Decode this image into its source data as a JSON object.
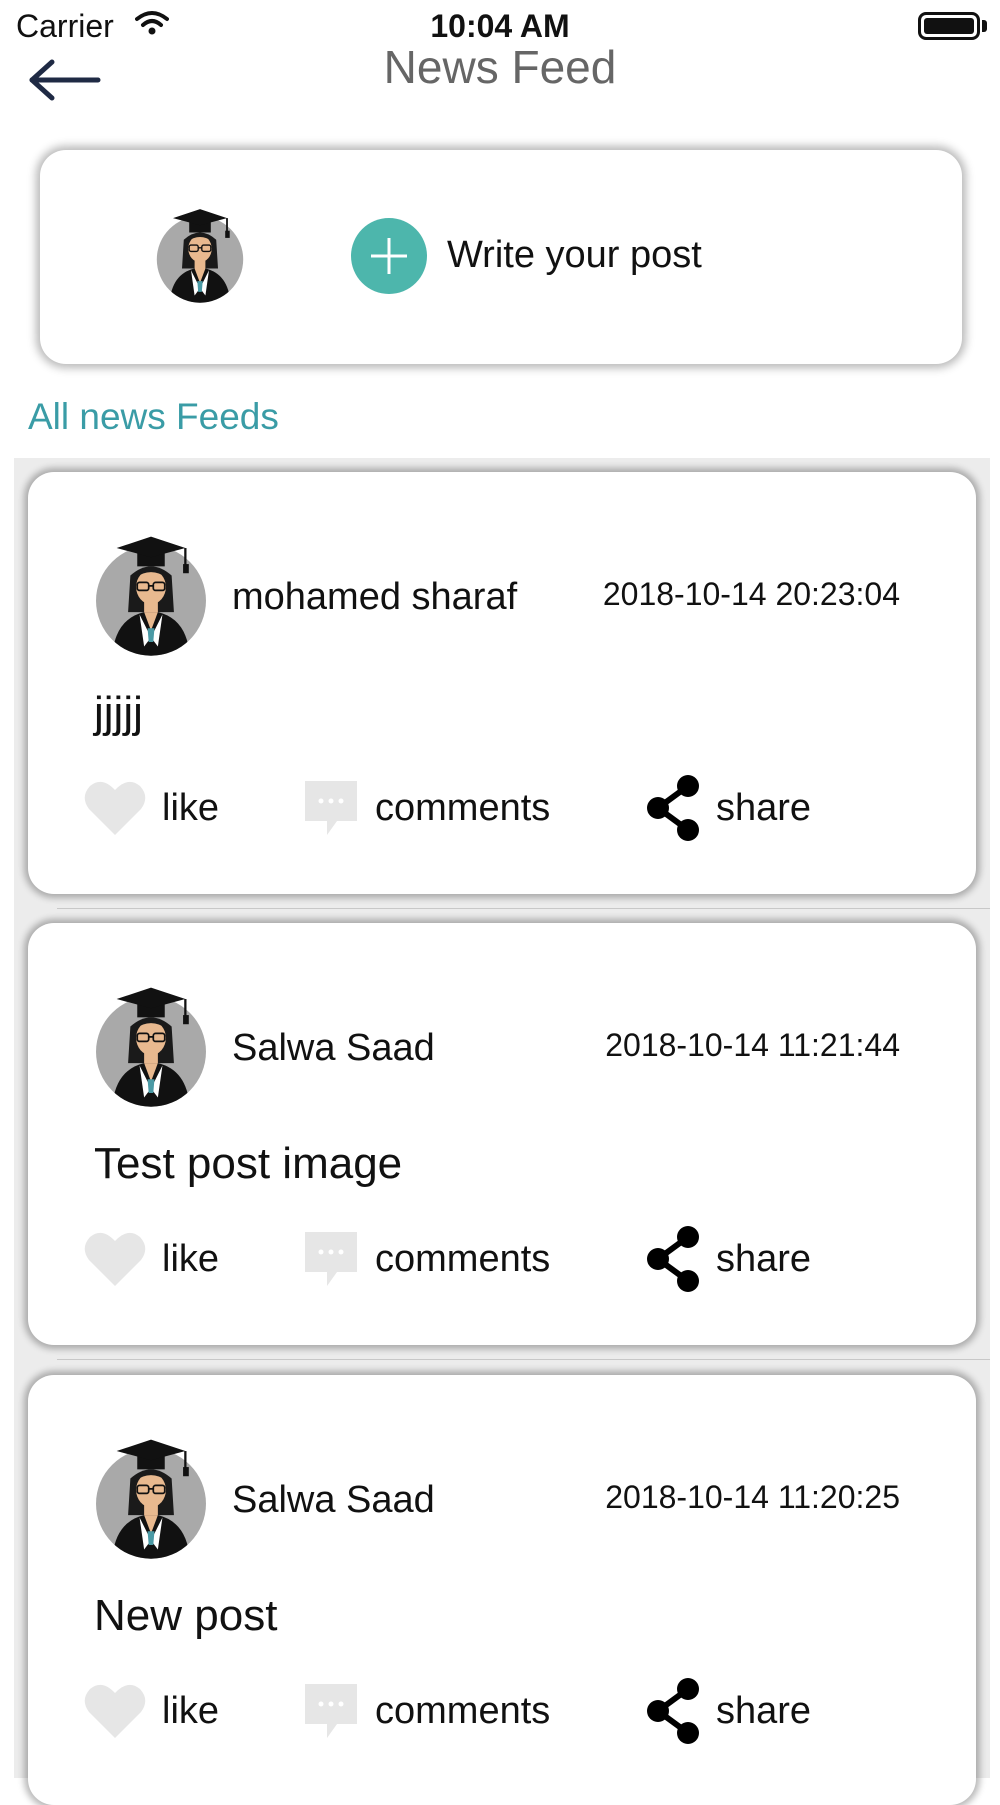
{
  "status_bar": {
    "carrier": "Carrier",
    "time": "10:04 AM",
    "wifi_icon": "wifi-icon",
    "battery_icon": "battery-icon"
  },
  "nav": {
    "title": "News Feed",
    "back_icon": "back-arrow-icon"
  },
  "compose": {
    "avatar_icon": "graduate-avatar-icon",
    "add_icon": "plus-circle-icon",
    "label": "Write your post",
    "accent_color": "#4db6ac"
  },
  "section": {
    "title": "All news Feeds",
    "color": "#3a9ca6"
  },
  "posts": [
    {
      "author": "mohamed sharaf",
      "time": "2018-10-14 20:23:04",
      "body": "jjjjj",
      "actions": {
        "like": "like",
        "comments": "comments",
        "share": "share"
      }
    },
    {
      "author": "Salwa Saad",
      "time": "2018-10-14 11:21:44",
      "body": "Test post image",
      "actions": {
        "like": "like",
        "comments": "comments",
        "share": "share"
      }
    },
    {
      "author": "Salwa Saad",
      "time": "2018-10-14 11:20:25",
      "body": "New post",
      "actions": {
        "like": "like",
        "comments": "comments",
        "share": "share"
      }
    }
  ],
  "icons": {
    "like": "heart-icon",
    "comments": "comment-bubble-icon",
    "share": "share-icon"
  }
}
